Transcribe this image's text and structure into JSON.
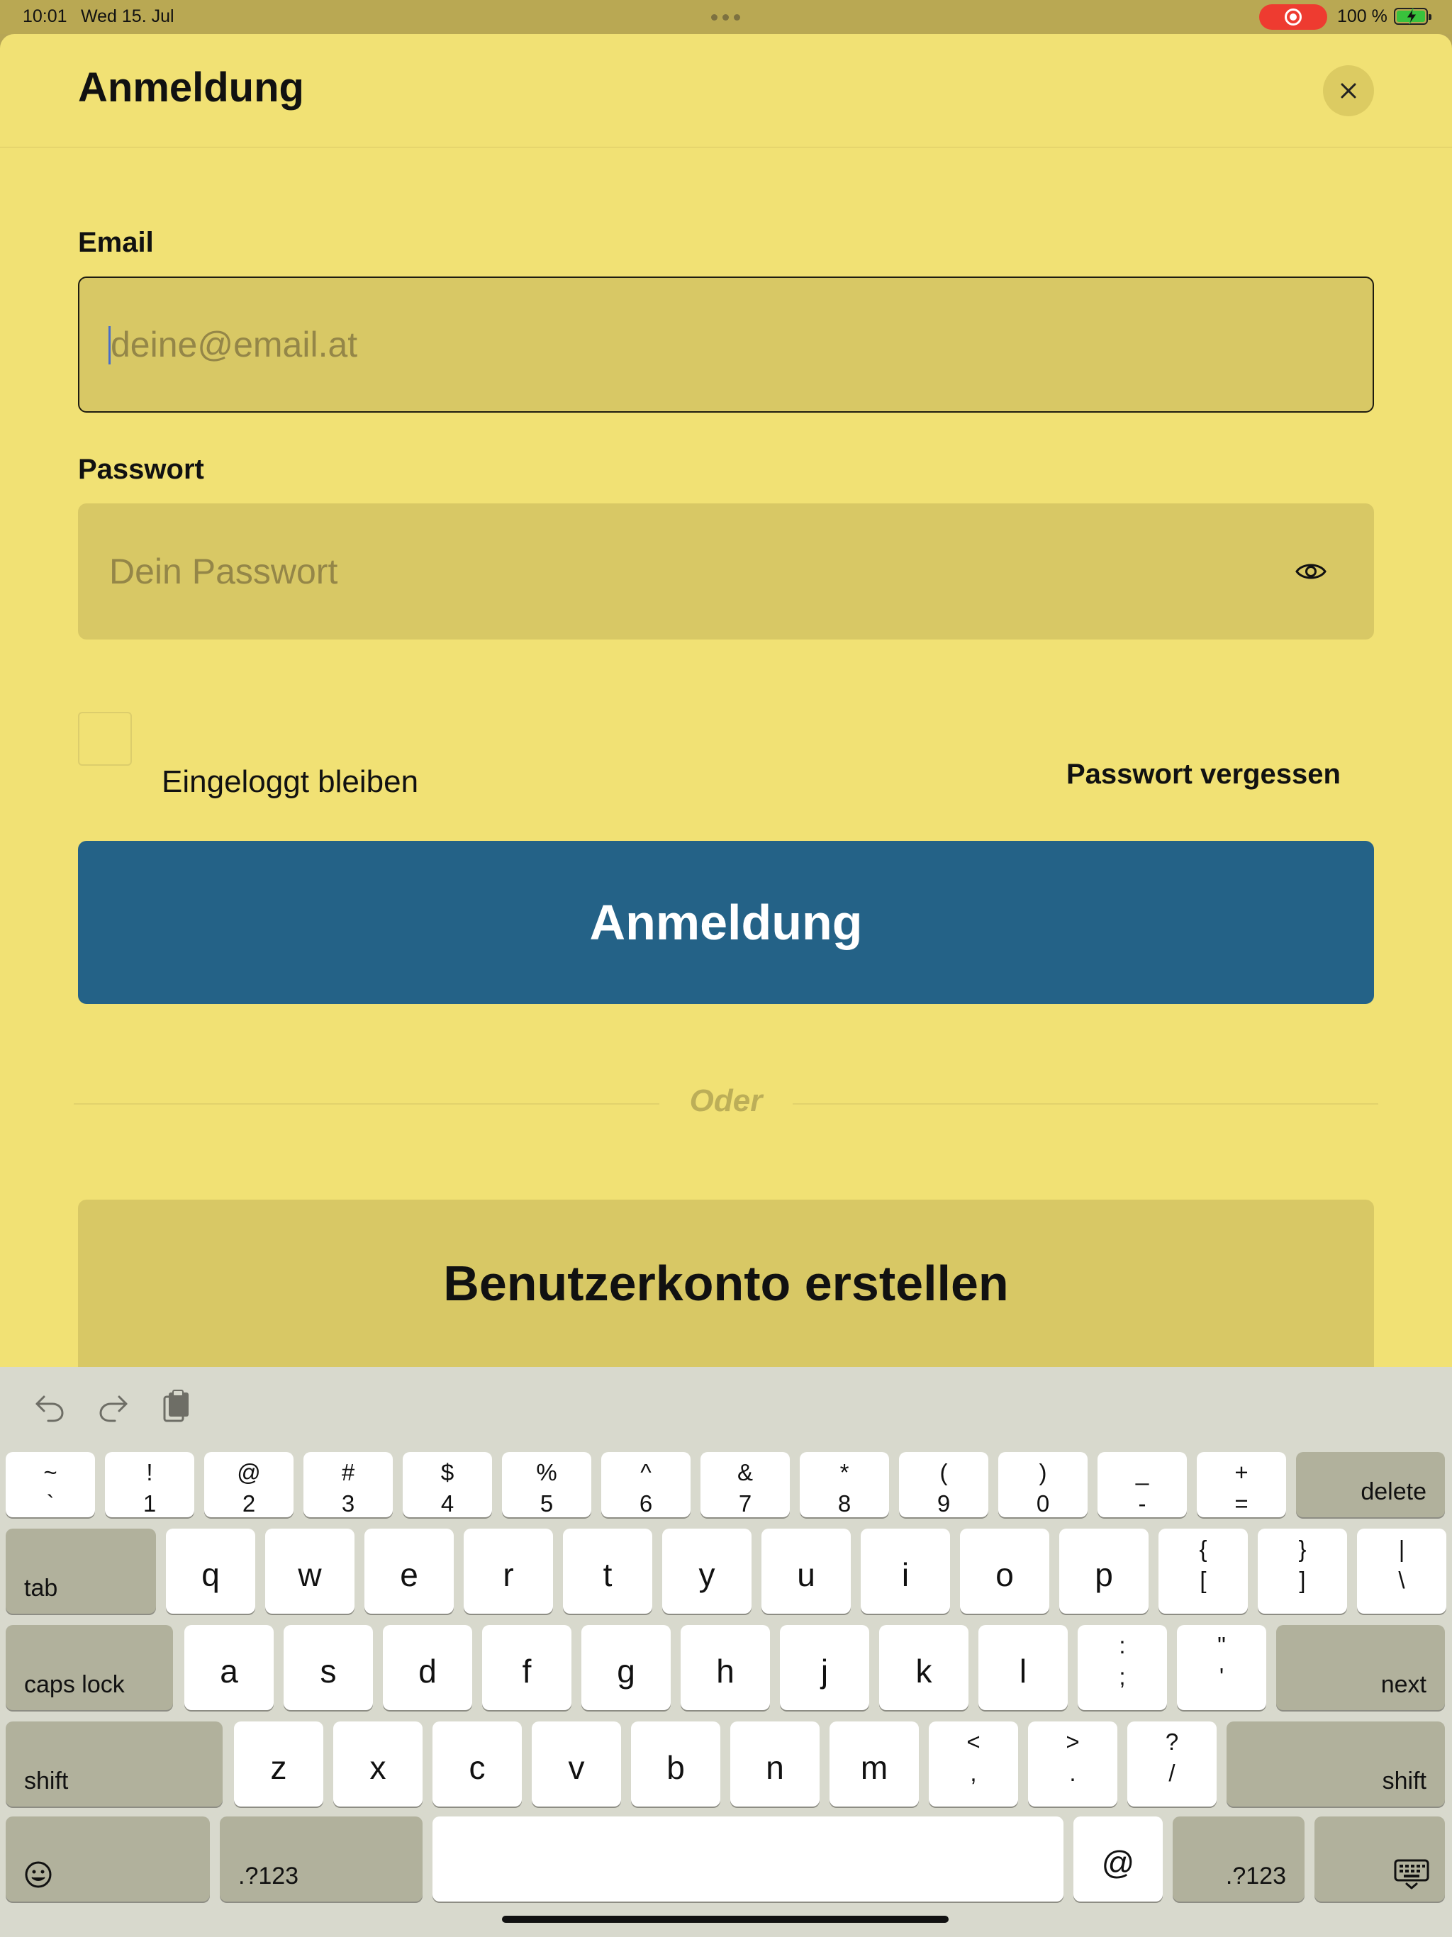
{
  "status_bar": {
    "time": "10:01",
    "date": "Wed 15. Jul",
    "battery": "100 %",
    "recording_color": "#ee3b30",
    "battery_color": "#39c23c"
  },
  "sheet": {
    "title": "Anmeldung",
    "close_icon": "close-icon",
    "background": "#f1e174"
  },
  "form": {
    "email_label": "Email",
    "email_placeholder": "deine@email.at",
    "email_value": "",
    "password_label": "Passwort",
    "password_placeholder": "Dein Passwort",
    "password_value": "",
    "show_password_icon": "eye-icon",
    "remember_label": "Eingeloggt bleiben",
    "remember_checked": false,
    "forgot_label": "Passwort vergessen",
    "login_label": "Anmeldung",
    "login_color": "#246287",
    "divider_label": "Oder",
    "register_label": "Benutzerkonto erstellen"
  },
  "keyboard": {
    "shortcuts": [
      "undo-icon",
      "redo-icon",
      "paste-icon"
    ],
    "number_row": [
      {
        "top": "~",
        "bottom": "`"
      },
      {
        "top": "!",
        "bottom": "1"
      },
      {
        "top": "@",
        "bottom": "2"
      },
      {
        "top": "#",
        "bottom": "3"
      },
      {
        "top": "$",
        "bottom": "4"
      },
      {
        "top": "%",
        "bottom": "5"
      },
      {
        "top": "^",
        "bottom": "6"
      },
      {
        "top": "&",
        "bottom": "7"
      },
      {
        "top": "*",
        "bottom": "8"
      },
      {
        "top": "(",
        "bottom": "9"
      },
      {
        "top": ")",
        "bottom": "0"
      },
      {
        "top": "_",
        "bottom": "-"
      },
      {
        "top": "+",
        "bottom": "="
      }
    ],
    "delete_label": "delete",
    "tab_label": "tab",
    "qwerty_row": [
      "q",
      "w",
      "e",
      "r",
      "t",
      "y",
      "u",
      "i",
      "o",
      "p"
    ],
    "qwerty_extra": [
      {
        "top": "{",
        "bottom": "["
      },
      {
        "top": "}",
        "bottom": "]"
      },
      {
        "top": "|",
        "bottom": "\\"
      }
    ],
    "caps_label": "caps lock",
    "home_row": [
      "a",
      "s",
      "d",
      "f",
      "g",
      "h",
      "j",
      "k",
      "l"
    ],
    "home_extra": [
      {
        "top": ":",
        "bottom": ";"
      },
      {
        "top": "\"",
        "bottom": "'"
      }
    ],
    "next_label": "next",
    "shift_label": "shift",
    "bottom_letters": [
      "z",
      "x",
      "c",
      "v",
      "b",
      "n",
      "m"
    ],
    "bottom_extra": [
      {
        "top": "<",
        "bottom": ","
      },
      {
        "top": ">",
        "bottom": "."
      },
      {
        "top": "?",
        "bottom": "/"
      }
    ],
    "emoji_icon": "emoji-icon",
    "numbers_label": ".?123",
    "at_label": "@",
    "dismiss_icon": "keyboard-dismiss-icon"
  }
}
